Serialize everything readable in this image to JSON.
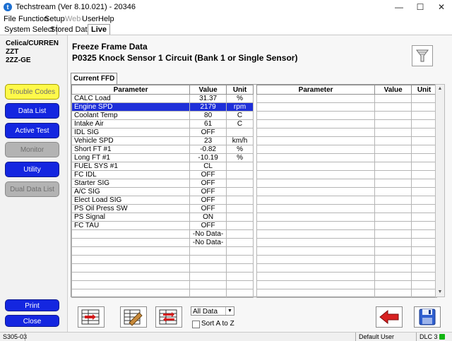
{
  "window": {
    "title": "Techstream (Ver 8.10.021) - 20346"
  },
  "menu": [
    "File",
    "Function",
    "Setup",
    "Web",
    "User",
    "Help"
  ],
  "tabs": [
    "System Select",
    "Stored Data",
    "Live"
  ],
  "sidebar": {
    "vehicle_line1": "Celica/CURREN ZZT",
    "vehicle_line2": "2ZZ-GE",
    "buttons": [
      "Trouble Codes",
      "Data List",
      "Active Test",
      "Monitor",
      "Utility",
      "Dual Data List"
    ],
    "print": "Print",
    "close": "Close"
  },
  "main": {
    "header": "Freeze Frame Data",
    "dtc": "P0325 Knock Sensor 1 Circuit (Bank 1 or Single Sensor)",
    "subtab": "Current FFD",
    "columns": [
      "Parameter",
      "Value",
      "Unit"
    ],
    "rows": [
      [
        "CALC Load",
        "31.37",
        "%"
      ],
      [
        "Engine SPD",
        "2179",
        "rpm"
      ],
      [
        "Coolant Temp",
        "80",
        "C"
      ],
      [
        "Intake Air",
        "61",
        "C"
      ],
      [
        "IDL SIG",
        "OFF",
        ""
      ],
      [
        "Vehicle SPD",
        "23",
        "km/h"
      ],
      [
        "Short FT #1",
        "-0.82",
        "%"
      ],
      [
        "Long FT #1",
        "-10.19",
        "%"
      ],
      [
        "FUEL SYS #1",
        "CL",
        ""
      ],
      [
        "FC IDL",
        "OFF",
        ""
      ],
      [
        "Starter SIG",
        "OFF",
        ""
      ],
      [
        "A/C SIG",
        "OFF",
        ""
      ],
      [
        "Elect Load SIG",
        "OFF",
        ""
      ],
      [
        "PS Oil Press SW",
        "OFF",
        ""
      ],
      [
        "PS Signal",
        "ON",
        ""
      ],
      [
        "FC TAU",
        "OFF",
        ""
      ],
      [
        "",
        "-No Data-",
        ""
      ],
      [
        "",
        "-No Data-",
        ""
      ]
    ],
    "selected_row": 1,
    "filter_select": "All Data",
    "sort_label": "Sort A to Z"
  },
  "statusbar": {
    "code": "S305-03",
    "user": "Default User",
    "port": "DLC 3"
  },
  "colors": {
    "button_blue": "#1426e0",
    "button_yellow": "#fff94a",
    "selected_row": "#1e2fd9"
  }
}
